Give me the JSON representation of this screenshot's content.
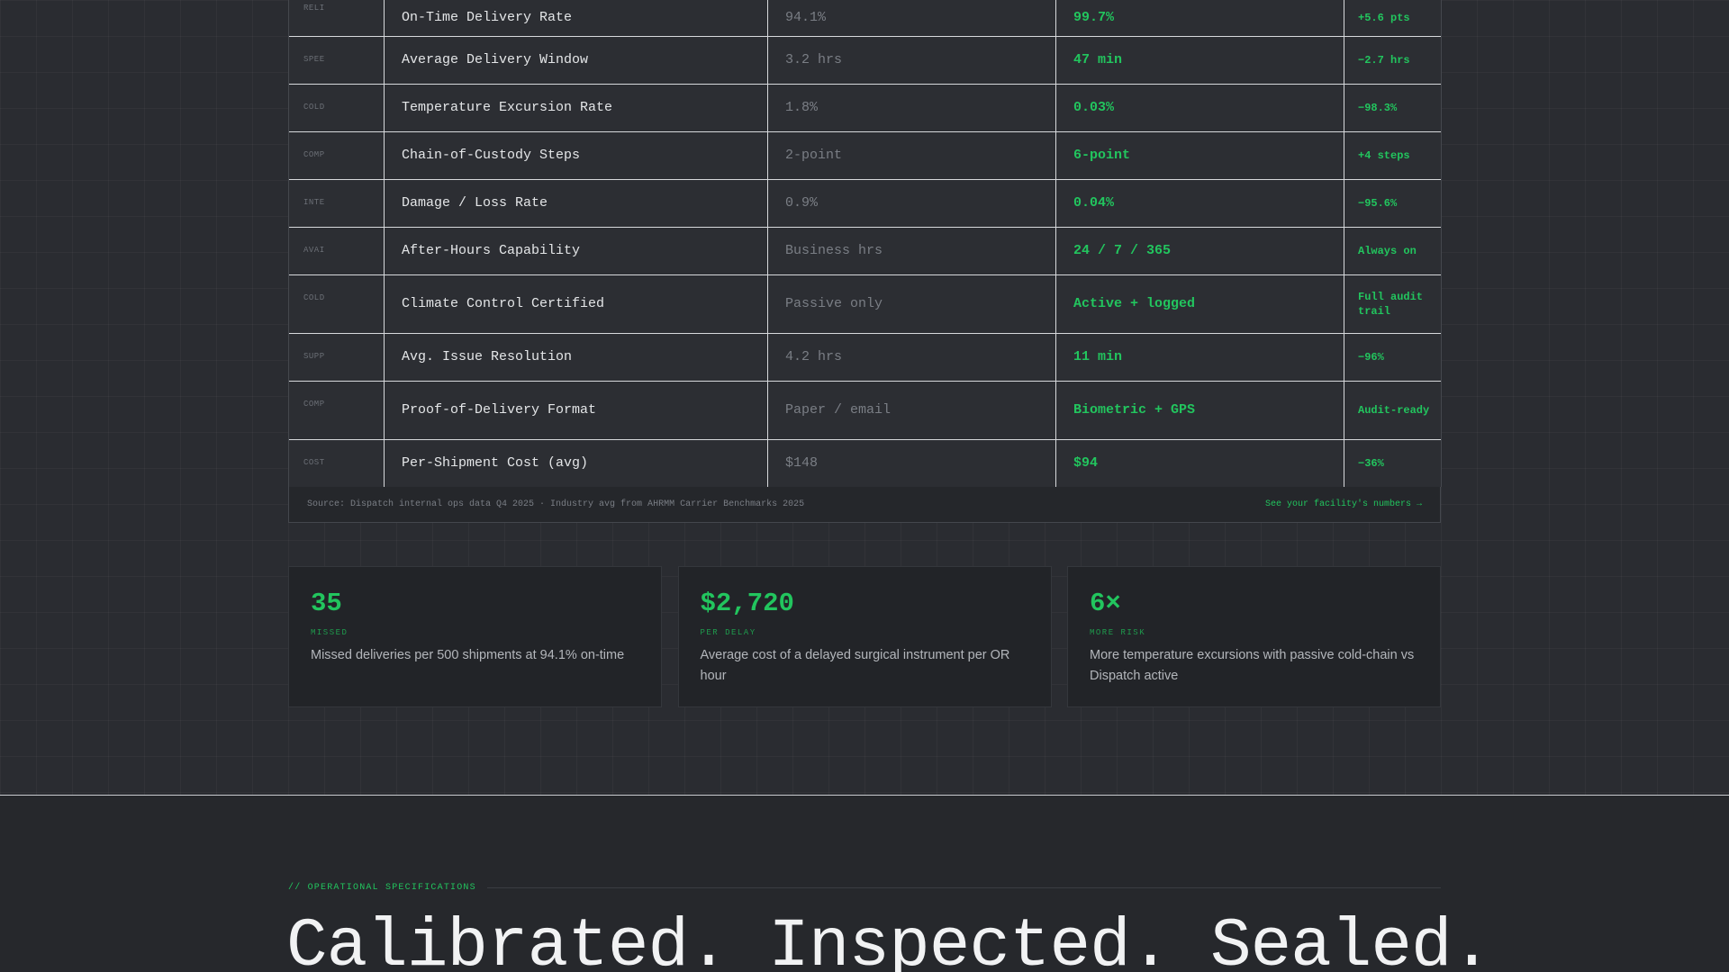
{
  "comparison_table": {
    "rows": [
      {
        "category": "RELI",
        "metric": "On-Time Delivery Rate",
        "industry": "94.1%",
        "dispatch": "99.7%",
        "delta": "+5.6 pts"
      },
      {
        "category": "SPEE",
        "metric": "Average Delivery Window",
        "industry": "3.2 hrs",
        "dispatch": "47 min",
        "delta": "−2.7 hrs"
      },
      {
        "category": "COLD",
        "metric": "Temperature Excursion Rate",
        "industry": "1.8%",
        "dispatch": "0.03%",
        "delta": "−98.3%"
      },
      {
        "category": "COMP",
        "metric": "Chain-of-Custody Steps",
        "industry": "2-point",
        "dispatch": "6-point",
        "delta": "+4 steps"
      },
      {
        "category": "INTE",
        "metric": "Damage / Loss Rate",
        "industry": "0.9%",
        "dispatch": "0.04%",
        "delta": "−95.6%"
      },
      {
        "category": "AVAI",
        "metric": "After-Hours Capability",
        "industry": "Business hrs",
        "dispatch": "24 / 7 / 365",
        "delta": "Always on"
      },
      {
        "category": "COLD",
        "metric": "Climate Control Certified",
        "industry": "Passive only",
        "dispatch": "Active + logged",
        "delta": "Full audit trail"
      },
      {
        "category": "SUPP",
        "metric": "Avg. Issue Resolution",
        "industry": "4.2 hrs",
        "dispatch": "11 min",
        "delta": "−96%"
      },
      {
        "category": "COMP",
        "metric": "Proof-of-Delivery Format",
        "industry": "Paper / email",
        "dispatch": "Biometric + GPS",
        "delta": "Audit-ready"
      },
      {
        "category": "COST",
        "metric": "Per-Shipment Cost (avg)",
        "industry": "$148",
        "dispatch": "$94",
        "delta": "−36%"
      }
    ],
    "source_note": "Source: Dispatch internal ops data Q4 2025 · Industry avg from AHRMM Carrier Benchmarks 2025",
    "facility_link": "See your facility's numbers →"
  },
  "stats": [
    {
      "value": "35",
      "label": "MISSED",
      "description": "Missed deliveries per 500 shipments at 94.1% on-time"
    },
    {
      "value": "$2,720",
      "label": "PER DELAY",
      "description": "Average cost of a delayed surgical instrument per OR hour"
    },
    {
      "value": "6×",
      "label": "MORE RISK",
      "description": "More temperature excursions with passive cold-chain vs Dispatch active"
    }
  ],
  "specs": {
    "eyebrow": "// OPERATIONAL SPECIFICATIONS",
    "headline": "Calibrated. Inspected. Sealed."
  },
  "colors": {
    "accent": "#22c55e",
    "background": "#2a2c31",
    "card": "#222428"
  }
}
